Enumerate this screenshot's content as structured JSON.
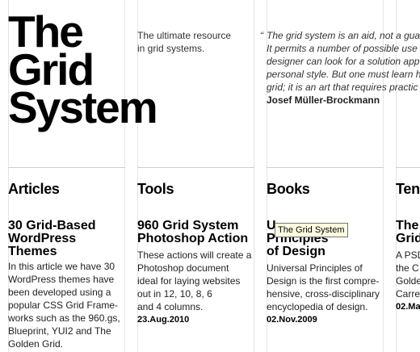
{
  "logo": {
    "line1": "The",
    "line2": "Grid",
    "line3": "System"
  },
  "tagline": {
    "line1": "The ultimate resource",
    "line2": "in grid systems."
  },
  "quote": {
    "open_mark": "“",
    "lines": [
      "The grid system is an aid, not a gua",
      "It permits a number of possible use",
      "designer can look for a solution app",
      "personal style. But one must learn h",
      "grid; it is an art that requires practic"
    ],
    "author": "Josef Müller-Brockmann"
  },
  "columns": [
    {
      "heading": "Articles",
      "title_lines": [
        "30 Grid-Based",
        "WordPress",
        "Themes"
      ],
      "desc_lines": [
        "In this article we have 30",
        "WordPress themes have",
        "been developed using a",
        "popular CSS Grid Frame-",
        "works such as the 960.gs,",
        "Blueprint, YUI2 and The",
        "Golden Grid."
      ],
      "date": ""
    },
    {
      "heading": "Tools",
      "title_lines": [
        "960 Grid System",
        "Photoshop Action"
      ],
      "desc_lines": [
        "These actions will create a",
        "Photoshop document",
        "ideal for laying websites",
        "out in 12, 10, 8, 6",
        "and 4 columns."
      ],
      "date": "23.Aug.2010"
    },
    {
      "heading": "Books",
      "title_lines": [
        "U",
        "Principles",
        "of Design"
      ],
      "desc_lines": [
        "Universal Principles of",
        "Design is the first compre-",
        "hensive, cross-disciplinary",
        "encyclopedia of design."
      ],
      "date": "02.Nov.2009"
    },
    {
      "heading": "Ten",
      "title_lines": [
        "The",
        "Grid"
      ],
      "desc_lines": [
        "A PSD",
        "the C",
        "Golde",
        "Carre"
      ],
      "date": "02.Ma"
    }
  ],
  "tooltip": {
    "text": "The Grid System"
  }
}
